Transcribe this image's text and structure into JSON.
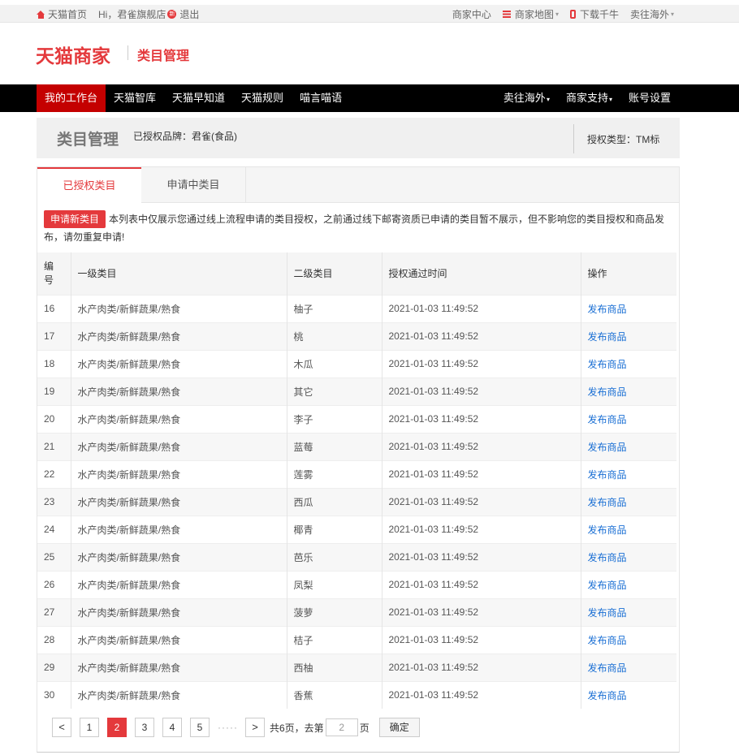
{
  "topbar": {
    "home": "天猫首页",
    "greeting": "Hi，君雀旗舰店",
    "badge": "新",
    "logout": "退出",
    "merchant_center": "商家中心",
    "merchant_map": "商家地图",
    "download": "下载千牛",
    "sell_abroad": "卖往海外",
    "caret": "▾"
  },
  "header": {
    "logo": "天猫商家",
    "subtitle": "类目管理"
  },
  "nav": {
    "left": [
      "我的工作台",
      "天猫智库",
      "天猫早知道",
      "天猫规则",
      "喵言喵语"
    ],
    "right": [
      "卖往海外",
      "商家支持",
      "账号设置"
    ]
  },
  "titlebar": {
    "title": "类目管理",
    "brand": "已授权品牌：君雀(食品)",
    "auth_type": "授权类型：TM标"
  },
  "tabs": {
    "authorized": "已授权类目",
    "applying": "申请中类目"
  },
  "notice": {
    "apply_button": "申请新类目",
    "text": "本列表中仅展示您通过线上流程申请的类目授权，之前通过线下邮寄资质已申请的类目暂不展示，但不影响您的类目授权和商品发布，请勿重复申请!"
  },
  "table": {
    "headers": [
      "编号",
      "一级类目",
      "二级类目",
      "授权通过时间",
      "操作"
    ],
    "action_label": "发布商品",
    "rows": [
      {
        "id": "16",
        "cat1": "水产肉类/新鲜蔬果/熟食",
        "cat2": "柚子",
        "time": "2021-01-03 11:49:52"
      },
      {
        "id": "17",
        "cat1": "水产肉类/新鲜蔬果/熟食",
        "cat2": "桃",
        "time": "2021-01-03 11:49:52"
      },
      {
        "id": "18",
        "cat1": "水产肉类/新鲜蔬果/熟食",
        "cat2": "木瓜",
        "time": "2021-01-03 11:49:52"
      },
      {
        "id": "19",
        "cat1": "水产肉类/新鲜蔬果/熟食",
        "cat2": "其它",
        "time": "2021-01-03 11:49:52"
      },
      {
        "id": "20",
        "cat1": "水产肉类/新鲜蔬果/熟食",
        "cat2": "李子",
        "time": "2021-01-03 11:49:52"
      },
      {
        "id": "21",
        "cat1": "水产肉类/新鲜蔬果/熟食",
        "cat2": "蓝莓",
        "time": "2021-01-03 11:49:52"
      },
      {
        "id": "22",
        "cat1": "水产肉类/新鲜蔬果/熟食",
        "cat2": "莲雾",
        "time": "2021-01-03 11:49:52"
      },
      {
        "id": "23",
        "cat1": "水产肉类/新鲜蔬果/熟食",
        "cat2": "西瓜",
        "time": "2021-01-03 11:49:52"
      },
      {
        "id": "24",
        "cat1": "水产肉类/新鲜蔬果/熟食",
        "cat2": "椰青",
        "time": "2021-01-03 11:49:52"
      },
      {
        "id": "25",
        "cat1": "水产肉类/新鲜蔬果/熟食",
        "cat2": "芭乐",
        "time": "2021-01-03 11:49:52"
      },
      {
        "id": "26",
        "cat1": "水产肉类/新鲜蔬果/熟食",
        "cat2": "凤梨",
        "time": "2021-01-03 11:49:52"
      },
      {
        "id": "27",
        "cat1": "水产肉类/新鲜蔬果/熟食",
        "cat2": "菠萝",
        "time": "2021-01-03 11:49:52"
      },
      {
        "id": "28",
        "cat1": "水产肉类/新鲜蔬果/熟食",
        "cat2": "桔子",
        "time": "2021-01-03 11:49:52"
      },
      {
        "id": "29",
        "cat1": "水产肉类/新鲜蔬果/熟食",
        "cat2": "西柚",
        "time": "2021-01-03 11:49:52"
      },
      {
        "id": "30",
        "cat1": "水产肉类/新鲜蔬果/熟食",
        "cat2": "香蕉",
        "time": "2021-01-03 11:49:52"
      }
    ]
  },
  "pager": {
    "prev": "<",
    "next": ">",
    "pages": [
      "1",
      "2",
      "3",
      "4",
      "5"
    ],
    "current": "2",
    "dots": "·····",
    "total_text": "共6页，去第",
    "page_suffix": "页",
    "input_value": "2",
    "ok": "确定"
  },
  "colors": {
    "brand_red": "#e4393c",
    "nav_active": "#c40000",
    "link_blue": "#1a6fd4"
  }
}
